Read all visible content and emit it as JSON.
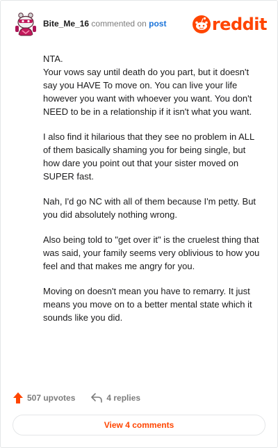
{
  "header": {
    "username": "Bite_Me_16",
    "commented_text": "commented on",
    "post_link": "post",
    "brand": "reddit",
    "brand_color": "#ff4500",
    "avatar_icon": "snoo-avatar-icon"
  },
  "comment": {
    "paragraphs": [
      "NTA.\nYour vows say until death do you part, but it doesn't say you HAVE To move on. You can live your life however you want with whoever you want. You don't NEED to be in a relationship if it isn't what you want.",
      "I also find it hilarious that they see no problem in ALL of them basically shaming you for being single, but how dare you point out that your sister moved on SUPER fast.",
      "Nah, I'd go NC with all of them because I'm petty. But you did absolutely nothing wrong.",
      "Also being told to \"get over it\" is the cruelest thing that was said, your family seems very oblivious to how you feel and that makes me angry for you.",
      "Moving on doesn't mean you have to remarry. It just means you move on to a better mental state which it sounds like you did."
    ]
  },
  "actions": {
    "upvotes_label": "507 upvotes",
    "replies_label": "4 replies",
    "upvote_icon": "upvote-arrow-icon",
    "reply_icon": "reply-arrow-icon"
  },
  "footer": {
    "view_comments_label": "View 4 comments"
  }
}
